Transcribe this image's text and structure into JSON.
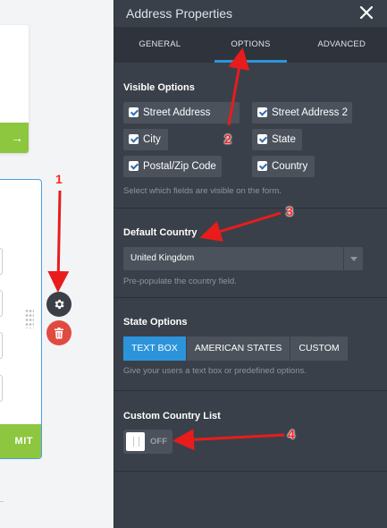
{
  "panel": {
    "title": "Address Properties",
    "close_glyph": "✕",
    "tabs": [
      {
        "label": "GENERAL",
        "active": false
      },
      {
        "label": "OPTIONS",
        "active": true
      },
      {
        "label": "ADVANCED",
        "active": false
      }
    ]
  },
  "visible_options": {
    "title": "Visible Options",
    "items": [
      {
        "label": "Street Address",
        "checked": true
      },
      {
        "label": "Street Address 2",
        "checked": true
      },
      {
        "label": "City",
        "checked": true
      },
      {
        "label": "State",
        "checked": true
      },
      {
        "label": "Postal/Zip Code",
        "checked": true
      },
      {
        "label": "Country",
        "checked": true
      }
    ],
    "hint": "Select which fields are visible on the form."
  },
  "default_country": {
    "title": "Default Country",
    "value": "United Kingdom",
    "hint": "Pre-populate the country field."
  },
  "state_options": {
    "title": "State Options",
    "buttons": [
      {
        "label": "TEXT BOX",
        "active": true
      },
      {
        "label": "AMERICAN STATES",
        "active": false
      },
      {
        "label": "CUSTOM",
        "active": false
      }
    ],
    "hint": "Give your users a text box or predefined options."
  },
  "custom_country": {
    "title": "Custom Country List",
    "toggle_label": "OFF",
    "enabled": false
  },
  "canvas": {
    "next_arrow": "→",
    "submit_label": "MIT"
  },
  "annotations": [
    "1",
    "2",
    "3",
    "4"
  ],
  "colors": {
    "accent": "#2d94db",
    "panel_bg": "#3a4049",
    "submit_green": "#8dc63f",
    "delete_red": "#e04b40",
    "annotation_red": "#ff2020"
  },
  "icons": [
    "gear-icon",
    "trash-icon",
    "close-icon",
    "checkbox-icon",
    "drag-handle-icon",
    "chevron-down-icon"
  ]
}
